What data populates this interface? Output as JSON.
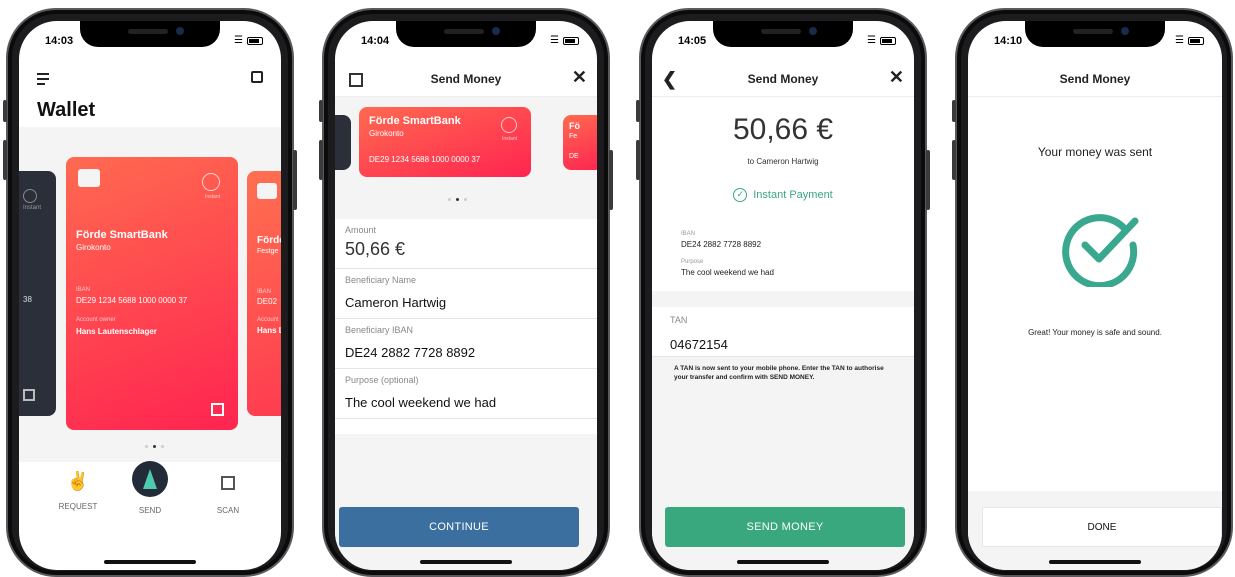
{
  "colors": {
    "accent_red": "#ff3a4f",
    "teal": "#3aa87e",
    "blue_button": "#3a6f9f",
    "dark_card": "#2a2f3a"
  },
  "screens": [
    {
      "time": "14:03",
      "header": {
        "title": "Wallet",
        "menu_icon": "menu-icon",
        "inbox_icon": "inbox-icon"
      },
      "card": {
        "bank": "Förde SmartBank",
        "account_type": "Girokonto",
        "iban_label": "IBAN",
        "iban": "DE29 1234 5688 1000 0000 37",
        "owner_label": "Account owner",
        "owner": "Hans Lautenschlager",
        "instant_label": "Instant"
      },
      "left_card": {
        "iban_fragment": "38",
        "instant_label": "Instant"
      },
      "right_card": {
        "bank": "Förde",
        "account_type": "Festge",
        "iban_label": "IBAN",
        "iban": "DE02",
        "owner_label": "Account",
        "owner": "Hans L"
      },
      "tabbar": {
        "request": "REQUEST",
        "send": "SEND",
        "scan": "SCAN"
      }
    },
    {
      "time": "14:04",
      "title": "Send Money",
      "card": {
        "bank": "Förde SmartBank",
        "account_type": "Girokonto",
        "iban": "DE29 1234 5688 1000 0000 37",
        "instant_label": "Instant"
      },
      "right_card": {
        "bank": "Fö",
        "account_type": "Fe",
        "iban": "DE"
      },
      "fields": [
        {
          "label": "Amount",
          "value": "50,66 €"
        },
        {
          "label": "Beneficiary Name",
          "value": "Cameron Hartwig"
        },
        {
          "label": "Beneficiary IBAN",
          "value": "DE24 2882 7728 8892"
        },
        {
          "label": "Purpose (optional)",
          "value": "The cool weekend we had"
        }
      ],
      "button": "CONTINUE"
    },
    {
      "time": "14:05",
      "title": "Send Money",
      "amount": "50,66 €",
      "to": "to Cameron Hartwig",
      "instant": "Instant Payment",
      "iban_label": "IBAN",
      "iban": "DE24 2882 7728 8892",
      "purpose_label": "Purpose",
      "purpose": "The cool weekend we had",
      "tan_label": "TAN",
      "tan": "04672154",
      "tan_info": "A TAN is now sent to your mobile phone. Enter the TAN to authorise your transfer and confirm with SEND MONEY.",
      "button": "SEND MONEY"
    },
    {
      "time": "14:10",
      "title": "Send Money",
      "heading": "Your money was sent",
      "message": "Great! Your money is safe and sound.",
      "button": "DONE"
    }
  ]
}
